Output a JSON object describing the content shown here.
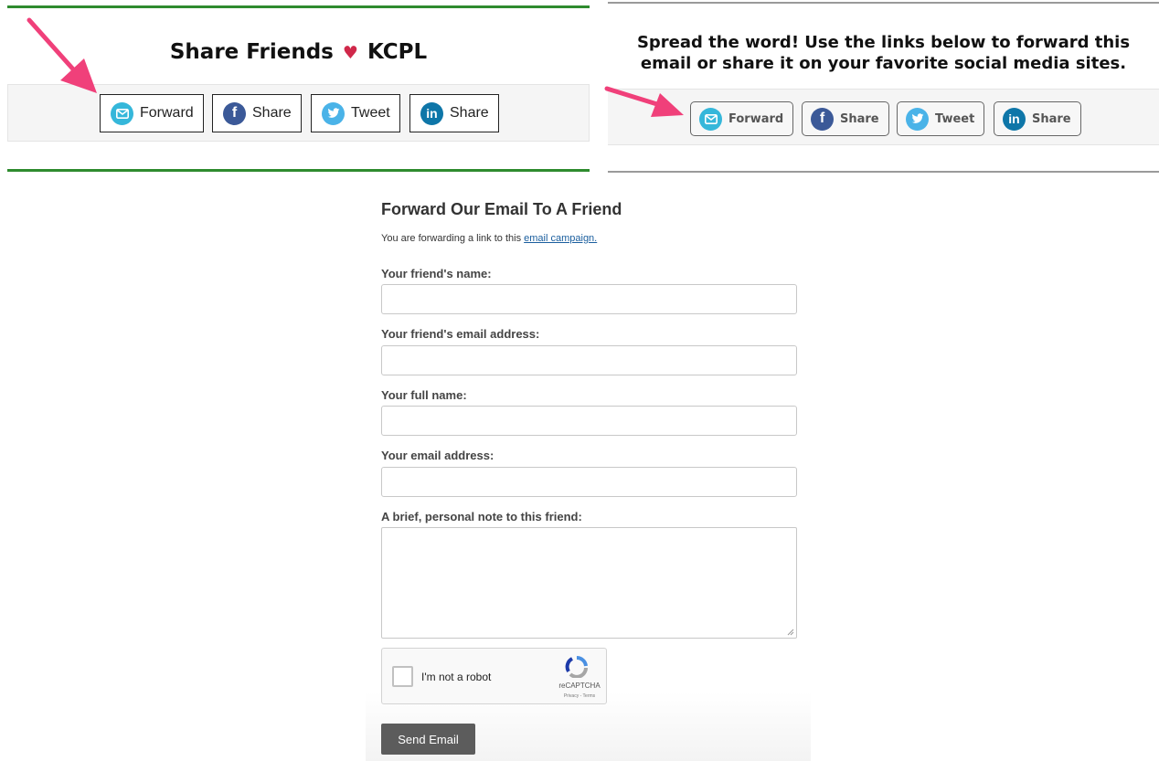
{
  "left_panel": {
    "heading_before": "Share Friends",
    "heading_heart": "♥",
    "heading_after": "KCPL",
    "buttons": [
      {
        "label": "Forward",
        "icon": "mail-icon"
      },
      {
        "label": "Share",
        "icon": "facebook-icon"
      },
      {
        "label": "Tweet",
        "icon": "twitter-icon"
      },
      {
        "label": "Share",
        "icon": "linkedin-icon"
      }
    ],
    "rule_color": "#2e8b2e"
  },
  "right_panel": {
    "heading_line1": "Spread the word! Use the links below to forward this",
    "heading_line2": "email or share it on your favorite social media sites.",
    "buttons": [
      {
        "label": "Forward",
        "icon": "mail-icon"
      },
      {
        "label": "Share",
        "icon": "facebook-icon"
      },
      {
        "label": "Tweet",
        "icon": "twitter-icon"
      },
      {
        "label": "Share",
        "icon": "linkedin-icon"
      }
    ]
  },
  "annotation_color": "#f0407a",
  "form": {
    "title": "Forward Our Email To A Friend",
    "subtitle_prefix": "You are forwarding a link to this ",
    "subtitle_link": "email campaign.",
    "fields": [
      {
        "label": "Your friend's name:",
        "value": ""
      },
      {
        "label": "Your friend's email address:",
        "value": ""
      },
      {
        "label": "Your full name:",
        "value": ""
      },
      {
        "label": "Your email address:",
        "value": ""
      },
      {
        "label": "A brief, personal note to this friend:",
        "value": ""
      }
    ],
    "captcha": {
      "label": "I'm not a robot",
      "brand": "reCAPTCHA",
      "terms": "Privacy - Terms",
      "checked": false
    },
    "submit_label": "Send Email"
  }
}
